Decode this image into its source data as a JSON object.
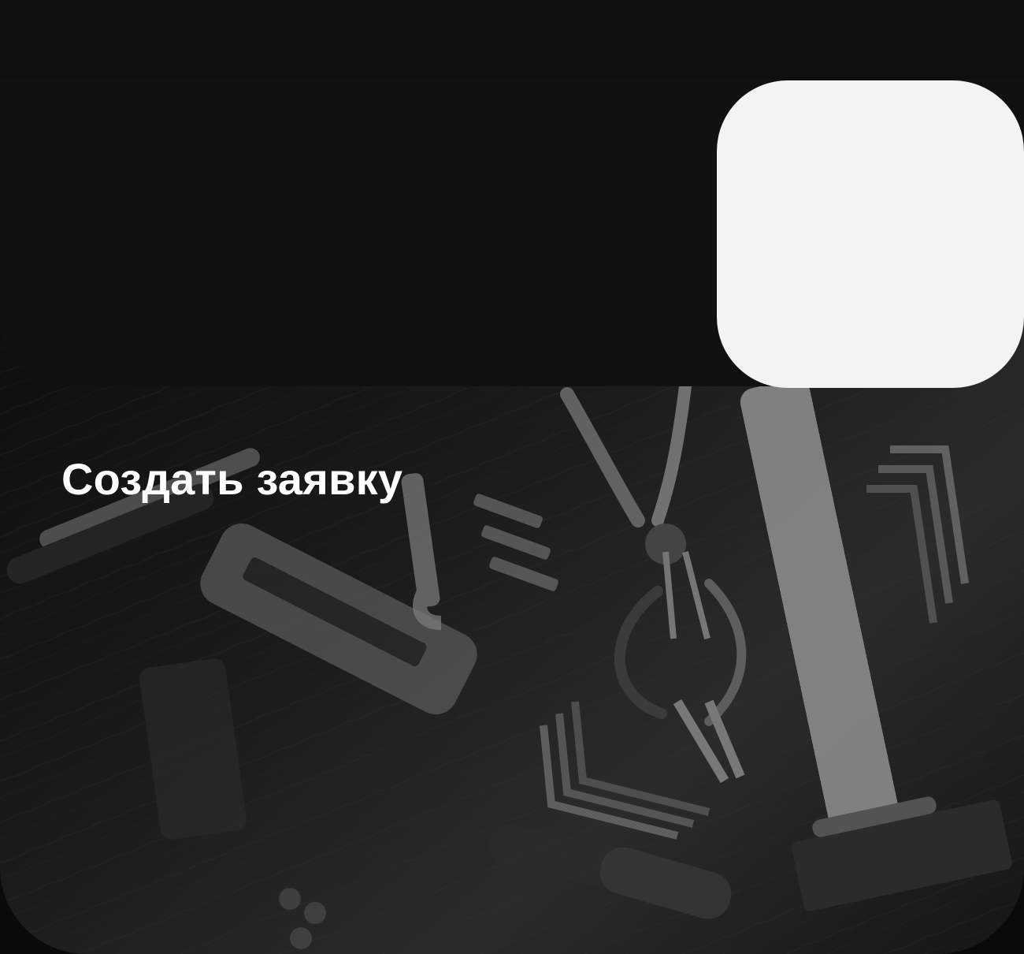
{
  "hero": {
    "title": "Создать заявку",
    "image": "tools-on-wood-background"
  },
  "colors": {
    "page": "#0a0a0a",
    "panel": "#111111",
    "card": "#f3f3f3",
    "title": "#ffffff"
  }
}
